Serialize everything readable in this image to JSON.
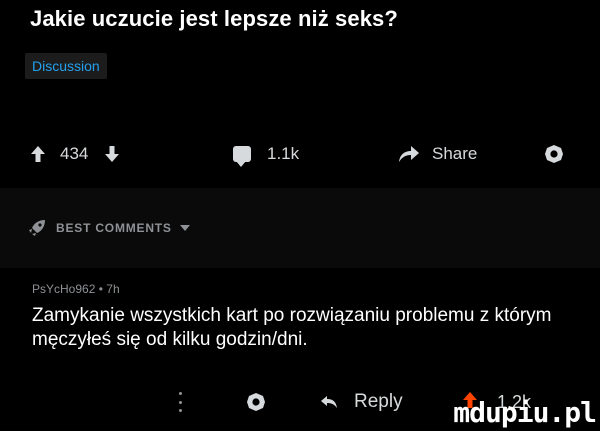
{
  "post": {
    "title": "Jakie uczucie jest lepsze niż seks?",
    "flair": "Discussion"
  },
  "actions": {
    "upvotes": "434",
    "comments": "1.1k",
    "share_label": "Share"
  },
  "comments_section": {
    "sort_label": "BEST COMMENTS"
  },
  "comment": {
    "author": "PsYcHo962",
    "separator": "•",
    "age": "7h",
    "text": "Zamykanie wszystkich kart po rozwiązaniu problemu z którym męczyłeś się od kilku godzin/dni.",
    "reply_label": "Reply",
    "votes": "1.2k"
  },
  "watermark": "mdupiu.pl",
  "colors": {
    "background": "#000000",
    "flair_text": "#24a0ed",
    "text": "#d7dadc",
    "muted": "#8e9195"
  }
}
